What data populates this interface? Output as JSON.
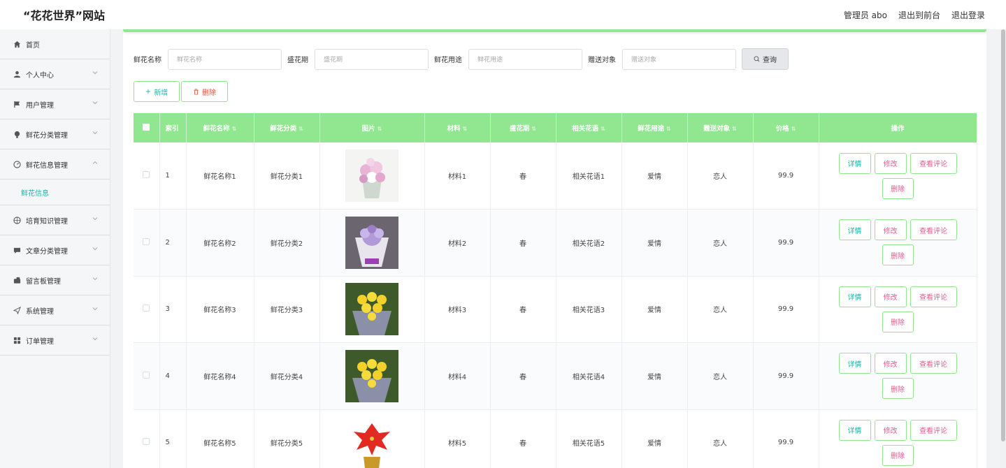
{
  "header": {
    "title": "“花花世界”网站",
    "user": "管理员 abo",
    "to_front": "退出到前台",
    "logout": "退出登录"
  },
  "sidebar": {
    "items": [
      {
        "label": "首页",
        "icon": "home-icon"
      },
      {
        "label": "个人中心",
        "icon": "user-icon"
      },
      {
        "label": "用户管理",
        "icon": "flag-icon"
      },
      {
        "label": "鲜花分类管理",
        "icon": "bulb-icon"
      },
      {
        "label": "鲜花信息管理",
        "icon": "dashboard-icon"
      },
      {
        "label": "培育知识管理",
        "icon": "compass-icon"
      },
      {
        "label": "文章分类管理",
        "icon": "chat-icon"
      },
      {
        "label": "留言板管理",
        "icon": "wallet-icon"
      },
      {
        "label": "系统管理",
        "icon": "send-icon"
      },
      {
        "label": "订单管理",
        "icon": "grid-icon"
      }
    ],
    "active_sub": "鲜花信息"
  },
  "search": {
    "name_label": "鲜花名称",
    "name_placeholder": "鲜花名称",
    "season_label": "盛花期",
    "season_placeholder": "盛花期",
    "use_label": "鲜花用途",
    "use_placeholder": "鲜花用途",
    "target_label": "赠送对象",
    "target_placeholder": "赠送对象",
    "query_label": "查询"
  },
  "actions": {
    "add_label": "新增",
    "delete_label": "删除"
  },
  "table": {
    "columns": [
      "索引",
      "鲜花名称",
      "鲜花分类",
      "图片",
      "材料",
      "盛花期",
      "相关花语",
      "鲜花用途",
      "赠送对象",
      "价格",
      "操作"
    ],
    "rows": [
      {
        "index": "1",
        "name": "鲜花名称1",
        "category": "鲜花分类1",
        "material": "材料1",
        "season": "春",
        "language": "相关花语1",
        "use": "爱情",
        "target": "恋人",
        "price": "99.9"
      },
      {
        "index": "2",
        "name": "鲜花名称2",
        "category": "鲜花分类2",
        "material": "材料2",
        "season": "春",
        "language": "相关花语2",
        "use": "爱情",
        "target": "恋人",
        "price": "99.9"
      },
      {
        "index": "3",
        "name": "鲜花名称3",
        "category": "鲜花分类3",
        "material": "材料3",
        "season": "春",
        "language": "相关花语3",
        "use": "爱情",
        "target": "恋人",
        "price": "99.9"
      },
      {
        "index": "4",
        "name": "鲜花名称4",
        "category": "鲜花分类4",
        "material": "材料4",
        "season": "春",
        "language": "相关花语4",
        "use": "爱情",
        "target": "恋人",
        "price": "99.9"
      },
      {
        "index": "5",
        "name": "鲜花名称5",
        "category": "鲜花分类5",
        "material": "材料5",
        "season": "春",
        "language": "相关花语5",
        "use": "爱情",
        "target": "恋人",
        "price": "99.9"
      }
    ],
    "row_ops": {
      "detail": "详情",
      "edit": "修改",
      "review": "查看评论",
      "delete": "删除"
    }
  },
  "colors": {
    "accent_green": "#90e790",
    "teal": "#20b2aa",
    "pink": "#e65a8c"
  }
}
